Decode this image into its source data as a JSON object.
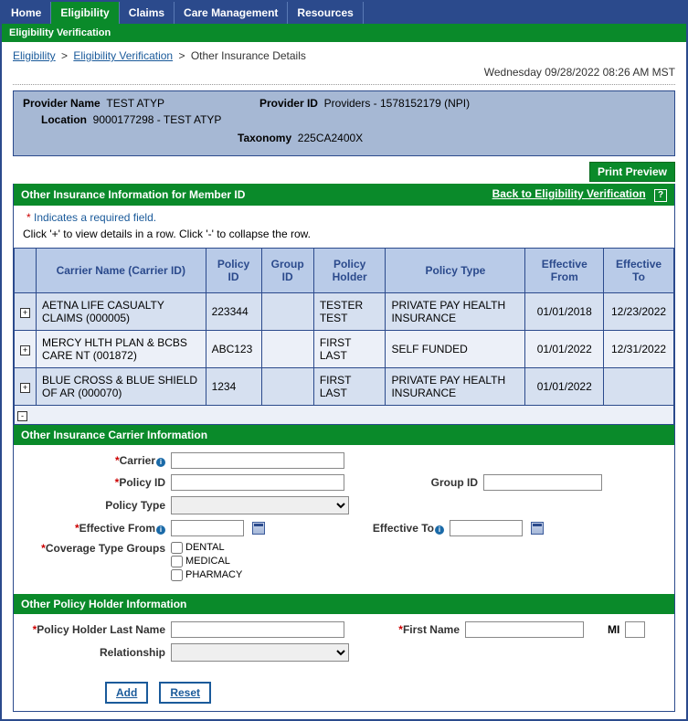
{
  "topnav": {
    "tabs": [
      "Home",
      "Eligibility",
      "Claims",
      "Care Management",
      "Resources"
    ],
    "activeIndex": 1
  },
  "subnav": "Eligibility Verification",
  "breadcrumb": {
    "link1": "Eligibility",
    "link2": "Eligibility Verification",
    "current": "Other Insurance Details"
  },
  "timestamp": "Wednesday 09/28/2022 08:26 AM MST",
  "provider": {
    "nameLabel": "Provider Name",
    "nameValue": "TEST ATYP",
    "idLabel": "Provider ID",
    "idValue": "Providers - 1578152179 (NPI)",
    "locLabel": "Location",
    "locValue": "9000177298 - TEST ATYP",
    "taxLabel": "Taxonomy",
    "taxValue": "225CA2400X"
  },
  "printPreview": "Print Preview",
  "section1": {
    "title": "Other Insurance Information for Member ID",
    "backLink": "Back to Eligibility Verification"
  },
  "requiredNote": "Indicates a required field.",
  "instruction": "Click '+' to view details in a row. Click '-' to collapse the row.",
  "grid": {
    "headers": [
      "",
      "Carrier Name (Carrier ID)",
      "Policy ID",
      "Group ID",
      "Policy Holder",
      "Policy Type",
      "Effective From",
      "Effective To"
    ],
    "rows": [
      {
        "carrier": "AETNA LIFE CASUALTY CLAIMS (000005)",
        "policyId": "223344",
        "groupId": "",
        "holder": "TESTER TEST",
        "type": "PRIVATE PAY HEALTH INSURANCE",
        "from": "01/01/2018",
        "to": "12/23/2022"
      },
      {
        "carrier": "MERCY HLTH PLAN & BCBS CARE NT (001872)",
        "policyId": "ABC123",
        "groupId": "",
        "holder": "FIRST LAST",
        "type": "SELF FUNDED",
        "from": "01/01/2022",
        "to": "12/31/2022"
      },
      {
        "carrier": "BLUE CROSS & BLUE SHIELD OF AR (000070)",
        "policyId": "1234",
        "groupId": "",
        "holder": "FIRST LAST",
        "type": "PRIVATE PAY HEALTH INSURANCE",
        "from": "01/01/2022",
        "to": ""
      }
    ]
  },
  "section2": "Other Insurance Carrier Information",
  "section3": "Other Policy Holder Information",
  "form": {
    "carrierLabel": "Carrier",
    "policyIdLabel": "Policy ID",
    "groupIdLabel": "Group ID",
    "policyTypeLabel": "Policy Type",
    "effFromLabel": "Effective From",
    "effToLabel": "Effective To",
    "coverageLabel": "Coverage Type Groups",
    "coverageOpts": [
      "DENTAL",
      "MEDICAL",
      "PHARMACY"
    ],
    "lastNameLabel": "Policy Holder Last Name",
    "firstNameLabel": "First Name",
    "miLabel": "MI",
    "relationshipLabel": "Relationship"
  },
  "buttons": {
    "add": "Add",
    "reset": "Reset"
  }
}
